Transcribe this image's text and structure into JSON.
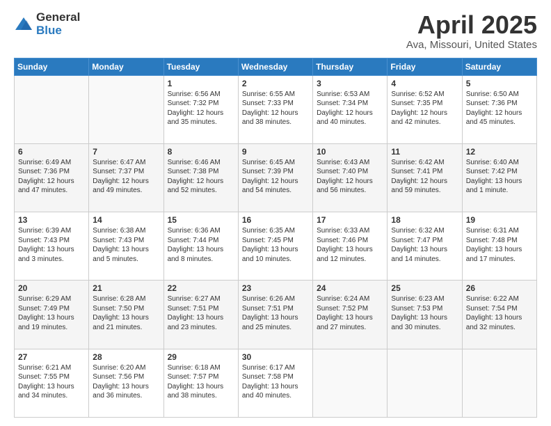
{
  "logo": {
    "general": "General",
    "blue": "Blue"
  },
  "header": {
    "title": "April 2025",
    "location": "Ava, Missouri, United States"
  },
  "weekdays": [
    "Sunday",
    "Monday",
    "Tuesday",
    "Wednesday",
    "Thursday",
    "Friday",
    "Saturday"
  ],
  "weeks": [
    [
      {
        "day": "",
        "sunrise": "",
        "sunset": "",
        "daylight": ""
      },
      {
        "day": "",
        "sunrise": "",
        "sunset": "",
        "daylight": ""
      },
      {
        "day": "1",
        "sunrise": "Sunrise: 6:56 AM",
        "sunset": "Sunset: 7:32 PM",
        "daylight": "Daylight: 12 hours and 35 minutes."
      },
      {
        "day": "2",
        "sunrise": "Sunrise: 6:55 AM",
        "sunset": "Sunset: 7:33 PM",
        "daylight": "Daylight: 12 hours and 38 minutes."
      },
      {
        "day": "3",
        "sunrise": "Sunrise: 6:53 AM",
        "sunset": "Sunset: 7:34 PM",
        "daylight": "Daylight: 12 hours and 40 minutes."
      },
      {
        "day": "4",
        "sunrise": "Sunrise: 6:52 AM",
        "sunset": "Sunset: 7:35 PM",
        "daylight": "Daylight: 12 hours and 42 minutes."
      },
      {
        "day": "5",
        "sunrise": "Sunrise: 6:50 AM",
        "sunset": "Sunset: 7:36 PM",
        "daylight": "Daylight: 12 hours and 45 minutes."
      }
    ],
    [
      {
        "day": "6",
        "sunrise": "Sunrise: 6:49 AM",
        "sunset": "Sunset: 7:36 PM",
        "daylight": "Daylight: 12 hours and 47 minutes."
      },
      {
        "day": "7",
        "sunrise": "Sunrise: 6:47 AM",
        "sunset": "Sunset: 7:37 PM",
        "daylight": "Daylight: 12 hours and 49 minutes."
      },
      {
        "day": "8",
        "sunrise": "Sunrise: 6:46 AM",
        "sunset": "Sunset: 7:38 PM",
        "daylight": "Daylight: 12 hours and 52 minutes."
      },
      {
        "day": "9",
        "sunrise": "Sunrise: 6:45 AM",
        "sunset": "Sunset: 7:39 PM",
        "daylight": "Daylight: 12 hours and 54 minutes."
      },
      {
        "day": "10",
        "sunrise": "Sunrise: 6:43 AM",
        "sunset": "Sunset: 7:40 PM",
        "daylight": "Daylight: 12 hours and 56 minutes."
      },
      {
        "day": "11",
        "sunrise": "Sunrise: 6:42 AM",
        "sunset": "Sunset: 7:41 PM",
        "daylight": "Daylight: 12 hours and 59 minutes."
      },
      {
        "day": "12",
        "sunrise": "Sunrise: 6:40 AM",
        "sunset": "Sunset: 7:42 PM",
        "daylight": "Daylight: 13 hours and 1 minute."
      }
    ],
    [
      {
        "day": "13",
        "sunrise": "Sunrise: 6:39 AM",
        "sunset": "Sunset: 7:43 PM",
        "daylight": "Daylight: 13 hours and 3 minutes."
      },
      {
        "day": "14",
        "sunrise": "Sunrise: 6:38 AM",
        "sunset": "Sunset: 7:43 PM",
        "daylight": "Daylight: 13 hours and 5 minutes."
      },
      {
        "day": "15",
        "sunrise": "Sunrise: 6:36 AM",
        "sunset": "Sunset: 7:44 PM",
        "daylight": "Daylight: 13 hours and 8 minutes."
      },
      {
        "day": "16",
        "sunrise": "Sunrise: 6:35 AM",
        "sunset": "Sunset: 7:45 PM",
        "daylight": "Daylight: 13 hours and 10 minutes."
      },
      {
        "day": "17",
        "sunrise": "Sunrise: 6:33 AM",
        "sunset": "Sunset: 7:46 PM",
        "daylight": "Daylight: 13 hours and 12 minutes."
      },
      {
        "day": "18",
        "sunrise": "Sunrise: 6:32 AM",
        "sunset": "Sunset: 7:47 PM",
        "daylight": "Daylight: 13 hours and 14 minutes."
      },
      {
        "day": "19",
        "sunrise": "Sunrise: 6:31 AM",
        "sunset": "Sunset: 7:48 PM",
        "daylight": "Daylight: 13 hours and 17 minutes."
      }
    ],
    [
      {
        "day": "20",
        "sunrise": "Sunrise: 6:29 AM",
        "sunset": "Sunset: 7:49 PM",
        "daylight": "Daylight: 13 hours and 19 minutes."
      },
      {
        "day": "21",
        "sunrise": "Sunrise: 6:28 AM",
        "sunset": "Sunset: 7:50 PM",
        "daylight": "Daylight: 13 hours and 21 minutes."
      },
      {
        "day": "22",
        "sunrise": "Sunrise: 6:27 AM",
        "sunset": "Sunset: 7:51 PM",
        "daylight": "Daylight: 13 hours and 23 minutes."
      },
      {
        "day": "23",
        "sunrise": "Sunrise: 6:26 AM",
        "sunset": "Sunset: 7:51 PM",
        "daylight": "Daylight: 13 hours and 25 minutes."
      },
      {
        "day": "24",
        "sunrise": "Sunrise: 6:24 AM",
        "sunset": "Sunset: 7:52 PM",
        "daylight": "Daylight: 13 hours and 27 minutes."
      },
      {
        "day": "25",
        "sunrise": "Sunrise: 6:23 AM",
        "sunset": "Sunset: 7:53 PM",
        "daylight": "Daylight: 13 hours and 30 minutes."
      },
      {
        "day": "26",
        "sunrise": "Sunrise: 6:22 AM",
        "sunset": "Sunset: 7:54 PM",
        "daylight": "Daylight: 13 hours and 32 minutes."
      }
    ],
    [
      {
        "day": "27",
        "sunrise": "Sunrise: 6:21 AM",
        "sunset": "Sunset: 7:55 PM",
        "daylight": "Daylight: 13 hours and 34 minutes."
      },
      {
        "day": "28",
        "sunrise": "Sunrise: 6:20 AM",
        "sunset": "Sunset: 7:56 PM",
        "daylight": "Daylight: 13 hours and 36 minutes."
      },
      {
        "day": "29",
        "sunrise": "Sunrise: 6:18 AM",
        "sunset": "Sunset: 7:57 PM",
        "daylight": "Daylight: 13 hours and 38 minutes."
      },
      {
        "day": "30",
        "sunrise": "Sunrise: 6:17 AM",
        "sunset": "Sunset: 7:58 PM",
        "daylight": "Daylight: 13 hours and 40 minutes."
      },
      {
        "day": "",
        "sunrise": "",
        "sunset": "",
        "daylight": ""
      },
      {
        "day": "",
        "sunrise": "",
        "sunset": "",
        "daylight": ""
      },
      {
        "day": "",
        "sunrise": "",
        "sunset": "",
        "daylight": ""
      }
    ]
  ]
}
